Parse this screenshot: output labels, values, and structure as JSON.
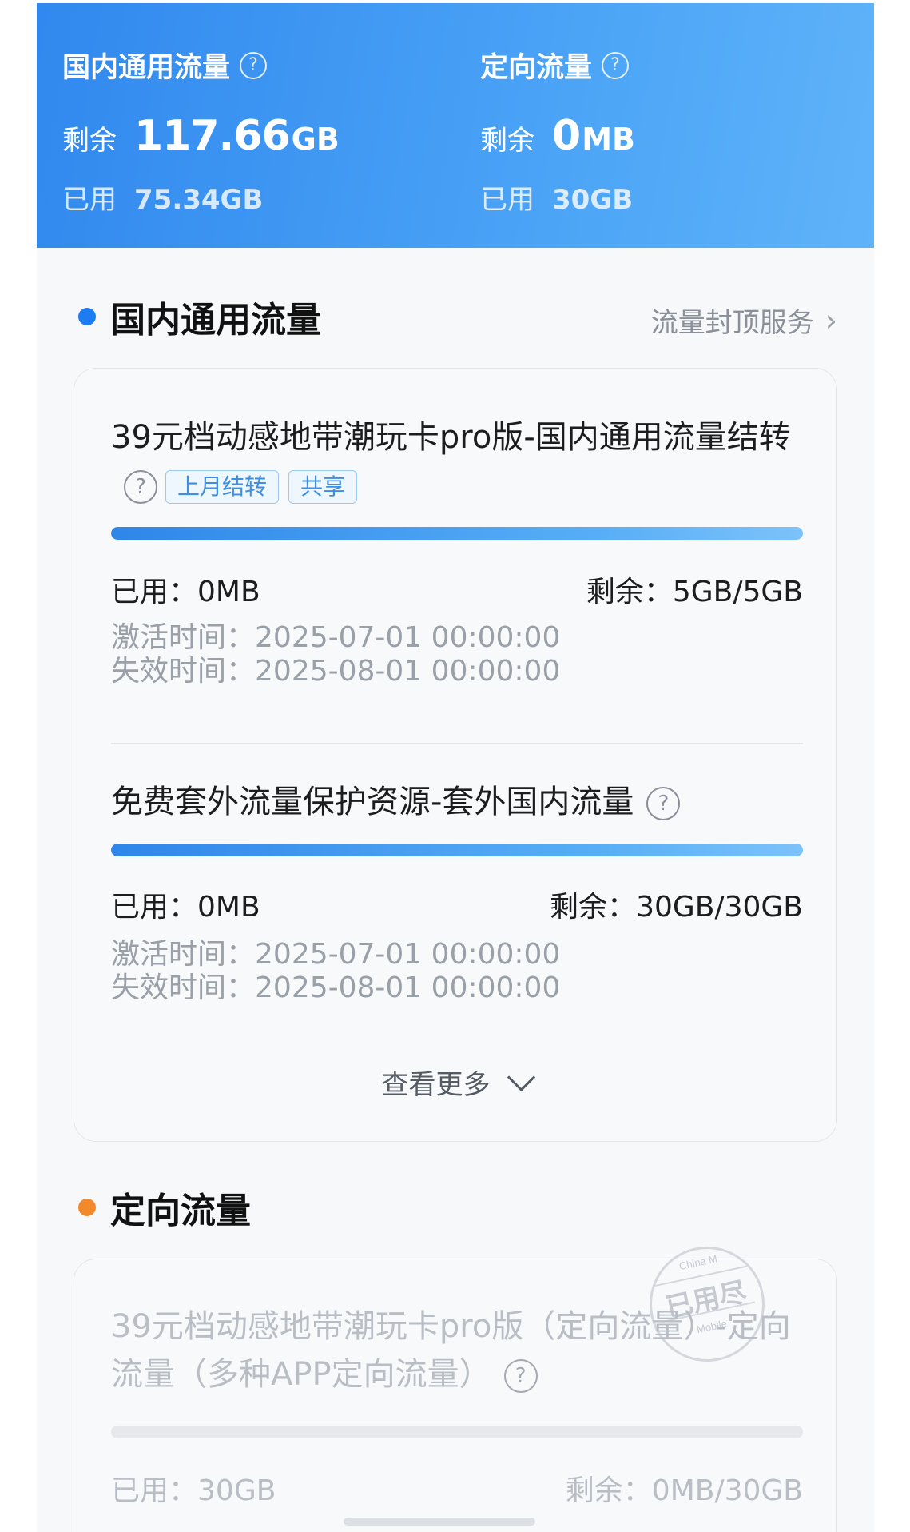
{
  "summary": {
    "general": {
      "title": "国内通用流量",
      "remain_label": "剩余",
      "remain_value": "117.66",
      "remain_unit": "GB",
      "used_label": "已用",
      "used_value": "75.34GB"
    },
    "directed": {
      "title": "定向流量",
      "remain_label": "剩余",
      "remain_value": "0",
      "remain_unit": "MB",
      "used_label": "已用",
      "used_value": "30GB"
    },
    "help_glyph": "?"
  },
  "general_section": {
    "title": "国内通用流量",
    "link_label": "流量封顶服务",
    "link_chevron": "›",
    "dot_color": "#1d7cf2",
    "packages": [
      {
        "name": "39元档动感地带潮玩卡pro版-国内通用流量结转",
        "tags": [
          "上月结转",
          "共享"
        ],
        "usage_fraction": 0.0,
        "used_label": "已用：",
        "used_value": "0MB",
        "remain_label": "剩余：",
        "remain_value": "5GB/5GB",
        "activate_label": "激活时间：",
        "activate_value": "2025-07-01 00:00:00",
        "expire_label": "失效时间：",
        "expire_value": "2025-08-01 00:00:00"
      },
      {
        "name": "免费套外流量保护资源-套外国内流量",
        "tags": [],
        "usage_fraction": 0.0,
        "used_label": "已用：",
        "used_value": "0MB",
        "remain_label": "剩余：",
        "remain_value": "30GB/30GB",
        "activate_label": "激活时间：",
        "activate_value": "2025-07-01 00:00:00",
        "expire_label": "失效时间：",
        "expire_value": "2025-08-01 00:00:00"
      }
    ],
    "more_label": "查看更多"
  },
  "directed_section": {
    "title": "定向流量",
    "dot_color": "#f28a2c",
    "packages": [
      {
        "name": "39元档动感地带潮玩卡pro版（定向流量）-定向流量（多种APP定向流量）",
        "usage_fraction": 1.0,
        "used_label": "已用：",
        "used_value": "30GB",
        "remain_label": "剩余：",
        "remain_value": "0MB/30GB",
        "stamp_text": "已用尽",
        "stamp_top": "China M",
        "stamp_bottom": "Mobile"
      }
    ]
  },
  "colors": {
    "header_gradient_start": "#3188ee",
    "header_gradient_end": "#5fb3f9",
    "accent_blue": "#2f86ea",
    "tag_text": "#3f8fe0"
  }
}
